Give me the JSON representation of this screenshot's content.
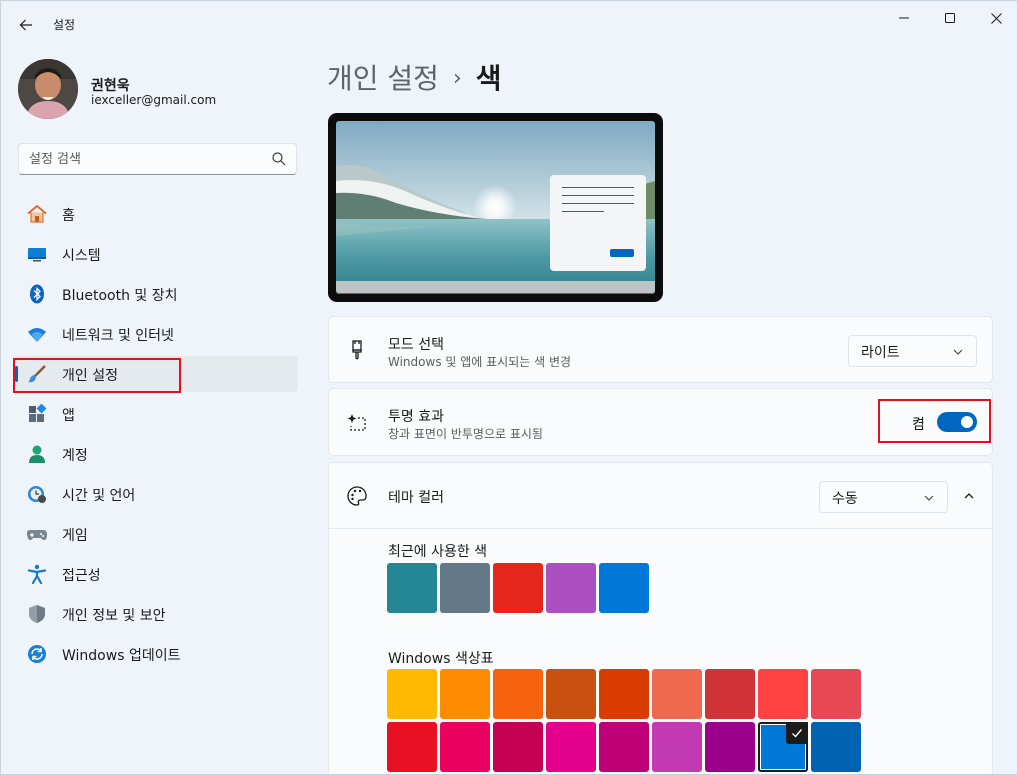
{
  "window": {
    "title": "설정"
  },
  "user": {
    "name": "권현욱",
    "email": "iexceller@gmail.com"
  },
  "search": {
    "placeholder": "설정 검색"
  },
  "nav": [
    {
      "key": "home",
      "label": "홈",
      "icon": "home-icon"
    },
    {
      "key": "system",
      "label": "시스템",
      "icon": "monitor-icon"
    },
    {
      "key": "bluetooth",
      "label": "Bluetooth 및 장치",
      "icon": "bluetooth-icon"
    },
    {
      "key": "network",
      "label": "네트워크 및 인터넷",
      "icon": "wifi-icon"
    },
    {
      "key": "personalization",
      "label": "개인 설정",
      "icon": "brush-icon",
      "active": true
    },
    {
      "key": "apps",
      "label": "앱",
      "icon": "apps-icon"
    },
    {
      "key": "accounts",
      "label": "계정",
      "icon": "person-icon"
    },
    {
      "key": "time",
      "label": "시간 및 언어",
      "icon": "globe-clock-icon"
    },
    {
      "key": "gaming",
      "label": "게임",
      "icon": "gamepad-icon"
    },
    {
      "key": "accessibility",
      "label": "접근성",
      "icon": "accessibility-icon"
    },
    {
      "key": "privacy",
      "label": "개인 정보 및 보안",
      "icon": "shield-icon"
    },
    {
      "key": "update",
      "label": "Windows 업데이트",
      "icon": "update-icon"
    }
  ],
  "breadcrumb": {
    "parent": "개인 설정",
    "separator": "›",
    "current": "색"
  },
  "mode": {
    "title": "모드 선택",
    "desc": "Windows 및 앱에 표시되는 색 변경",
    "value": "라이트",
    "icon": "paint-brush-icon"
  },
  "transparency": {
    "title": "투명 효과",
    "desc": "창과 표면이 반투명으로 표시됨",
    "state": "켬",
    "on": true,
    "icon": "sparkle-icon"
  },
  "theme_color": {
    "title": "테마 컬러",
    "value": "수동",
    "icon": "palette-icon"
  },
  "recent": {
    "label": "최근에 사용한 색",
    "colors": [
      "#258795",
      "#647988",
      "#e3281b",
      "#ab4fc1",
      "#0078d7"
    ]
  },
  "palette": {
    "label": "Windows 색상표",
    "row1": [
      "#ffb900",
      "#ff8c00",
      "#f7630c",
      "#ca5010",
      "#da3b01",
      "#ef6950",
      "#d13438",
      "#ff4343",
      "#e74856"
    ],
    "row2": [
      "#e81123",
      "#ea005e",
      "#c30052",
      "#e3008c",
      "#bf0077",
      "#c239b3",
      "#9a0089",
      "#0078d7",
      "#0063b1"
    ],
    "selected_index": 7
  },
  "colors": {
    "accent": "#0067c0",
    "highlight": "#e0131d"
  }
}
